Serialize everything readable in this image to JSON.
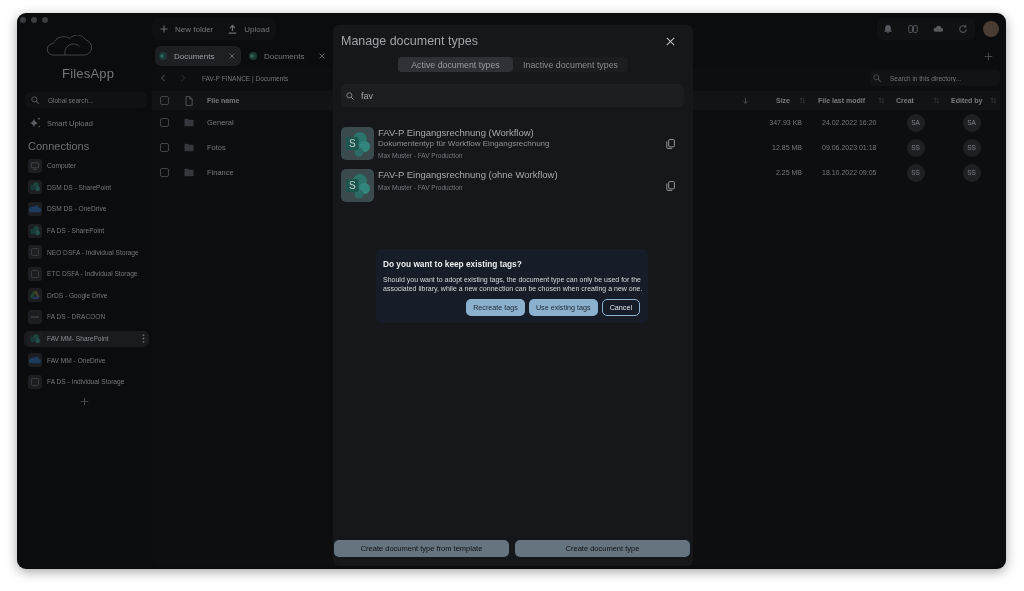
{
  "window": {
    "app_name": "FilesApp"
  },
  "sidebar": {
    "search": {
      "placeholder": "Global search..."
    },
    "smart_upload": "Smart Upload",
    "connections_title": "Connections",
    "connections": [
      {
        "label": "Computer",
        "kind": "computer",
        "selected": false
      },
      {
        "label": "DSM DS - SharePoint",
        "kind": "sharepoint",
        "selected": false
      },
      {
        "label": "DSM DS - OneDrive",
        "kind": "onedrive",
        "selected": false
      },
      {
        "label": "FA DS - SharePoint",
        "kind": "sharepoint",
        "selected": false
      },
      {
        "label": "NEO DSFA - Individual Storage",
        "kind": "storage",
        "selected": false
      },
      {
        "label": "ETC DSFA - Individual Storage",
        "kind": "storage",
        "selected": false
      },
      {
        "label": "DrDS - Google Drive",
        "kind": "google_drive",
        "selected": false
      },
      {
        "label": "FA DS - DRACOON",
        "kind": "dracoon",
        "selected": false
      },
      {
        "label": "FAV MM- SharePoint",
        "kind": "sharepoint",
        "selected": true
      },
      {
        "label": "FAV MM - OneDrive",
        "kind": "onedrive",
        "selected": false
      },
      {
        "label": "FA DS - Individual Storage",
        "kind": "storage",
        "selected": false
      }
    ]
  },
  "toolbar": {
    "buttons": [
      {
        "label": "New folder",
        "kind": "add"
      },
      {
        "label": "Upload",
        "kind": "upload"
      }
    ]
  },
  "tabs": [
    {
      "label": "Documents",
      "selected": true
    },
    {
      "label": "Documents",
      "selected": false
    }
  ],
  "breadcrumb": "FAV-P FINANCE | Documents",
  "directory_search": {
    "placeholder": "Search in this directory..."
  },
  "table": {
    "select_all_checked": false,
    "columns": [
      {
        "label": "File name",
        "sorted": true
      },
      {
        "label": "Size",
        "sorted": false
      },
      {
        "label": "File last modif",
        "sorted": false
      },
      {
        "label": "Creat",
        "sorted": false
      },
      {
        "label": "Edited by",
        "sorted": false
      }
    ],
    "rows": [
      {
        "name": "General",
        "checked": false,
        "size": "347.93 KB",
        "modified": "24.02.2022 16:20",
        "created_by": "SA",
        "edited_by": "SA"
      },
      {
        "name": "Fotos",
        "checked": false,
        "size": "12.85 MB",
        "modified": "09.06.2023 01:18",
        "created_by": "SS",
        "edited_by": "SS"
      },
      {
        "name": "Finance",
        "checked": false,
        "size": "2.25 MB",
        "modified": "18.10.2022 09:05",
        "created_by": "SS",
        "edited_by": "SS"
      }
    ]
  },
  "modal": {
    "title": "Manage document types",
    "segments": [
      {
        "label": "Active document types",
        "selected": true
      },
      {
        "label": "Inactive document types",
        "selected": false
      }
    ],
    "search": {
      "value": "fav"
    },
    "items": [
      {
        "logo_letter": "S",
        "title": "FAV-P Eingangsrechnung (Workflow)",
        "description": "Dokumententyp für Workflow Eingangsrechnung",
        "meta": "Max Muster - FAV Production"
      },
      {
        "logo_letter": "S",
        "title": "FAV-P Eingangsrechnung (ohne Workflow)",
        "meta": "Max Muster - FAV Production"
      }
    ],
    "buttons": [
      {
        "label": "Create document type from template"
      },
      {
        "label": "Create document type"
      }
    ]
  },
  "dialog": {
    "title": "Do you want to keep existing tags?",
    "body": "Should you want to adopt existing tags, the document type can only be used for the associated library, while a new connection can be chosen when creating a new one.",
    "buttons": [
      {
        "label": "Recreate tags",
        "kind": "primary"
      },
      {
        "label": "Use existing tags",
        "kind": "primary"
      },
      {
        "label": "Cancel",
        "kind": "outline"
      }
    ]
  }
}
